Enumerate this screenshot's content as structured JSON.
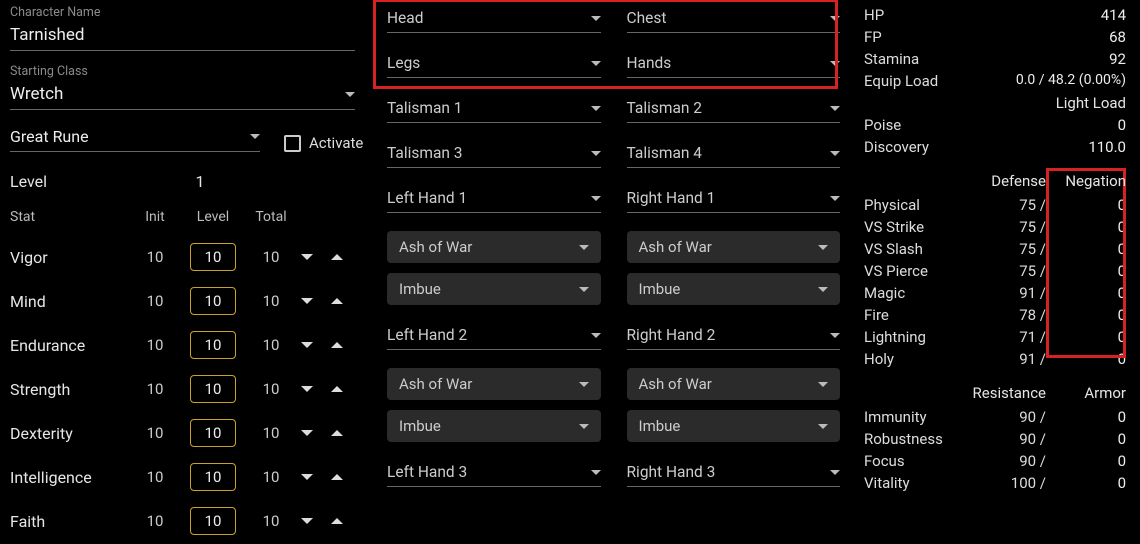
{
  "character": {
    "name_label": "Character Name",
    "name_value": "Tarnished",
    "class_label": "Starting Class",
    "class_value": "Wretch",
    "great_rune_label": "Great Rune",
    "activate_label": "Activate",
    "level_label": "Level",
    "level_value": "1"
  },
  "stat_header": {
    "stat": "Stat",
    "init": "Init",
    "level": "Level",
    "total": "Total"
  },
  "stats": [
    {
      "name": "Vigor",
      "init": "10",
      "level": "10",
      "total": "10"
    },
    {
      "name": "Mind",
      "init": "10",
      "level": "10",
      "total": "10"
    },
    {
      "name": "Endurance",
      "init": "10",
      "level": "10",
      "total": "10"
    },
    {
      "name": "Strength",
      "init": "10",
      "level": "10",
      "total": "10"
    },
    {
      "name": "Dexterity",
      "init": "10",
      "level": "10",
      "total": "10"
    },
    {
      "name": "Intelligence",
      "init": "10",
      "level": "10",
      "total": "10"
    },
    {
      "name": "Faith",
      "init": "10",
      "level": "10",
      "total": "10"
    }
  ],
  "armor": {
    "head": "Head",
    "chest": "Chest",
    "legs": "Legs",
    "hands": "Hands"
  },
  "talismans": {
    "t1": "Talisman 1",
    "t2": "Talisman 2",
    "t3": "Talisman 3",
    "t4": "Talisman 4"
  },
  "weapons": {
    "lh1": "Left Hand 1",
    "rh1": "Right Hand 1",
    "lh2": "Left Hand 2",
    "rh2": "Right Hand 2",
    "lh3": "Left Hand 3",
    "rh3": "Right Hand 3",
    "ash": "Ash of War",
    "imbue": "Imbue"
  },
  "primary": {
    "hp": {
      "k": "HP",
      "v": "414"
    },
    "fp": {
      "k": "FP",
      "v": "68"
    },
    "stamina": {
      "k": "Stamina",
      "v": "92"
    },
    "equip": {
      "k": "Equip Load",
      "v": "0.0 / 48.2 (0.00%)"
    },
    "load_text": "Light Load",
    "poise": {
      "k": "Poise",
      "v": "0"
    },
    "discovery": {
      "k": "Discovery",
      "v": "110.0"
    }
  },
  "defense": {
    "h1": "Defense",
    "h2": "Negation",
    "rows": [
      {
        "k": "Physical",
        "a": "75 /",
        "b": "0"
      },
      {
        "k": "VS Strike",
        "a": "75 /",
        "b": "0"
      },
      {
        "k": "VS Slash",
        "a": "75 /",
        "b": "0"
      },
      {
        "k": "VS Pierce",
        "a": "75 /",
        "b": "0"
      },
      {
        "k": "Magic",
        "a": "91 /",
        "b": "0"
      },
      {
        "k": "Fire",
        "a": "78 /",
        "b": "0"
      },
      {
        "k": "Lightning",
        "a": "71 /",
        "b": "0"
      },
      {
        "k": "Holy",
        "a": "91 /",
        "b": "0"
      }
    ]
  },
  "resist": {
    "h1": "Resistance",
    "h2": "Armor",
    "rows": [
      {
        "k": "Immunity",
        "a": "90 /",
        "b": "0"
      },
      {
        "k": "Robustness",
        "a": "90 /",
        "b": "0"
      },
      {
        "k": "Focus",
        "a": "90 /",
        "b": "0"
      },
      {
        "k": "Vitality",
        "a": "100 /",
        "b": "0"
      }
    ]
  }
}
